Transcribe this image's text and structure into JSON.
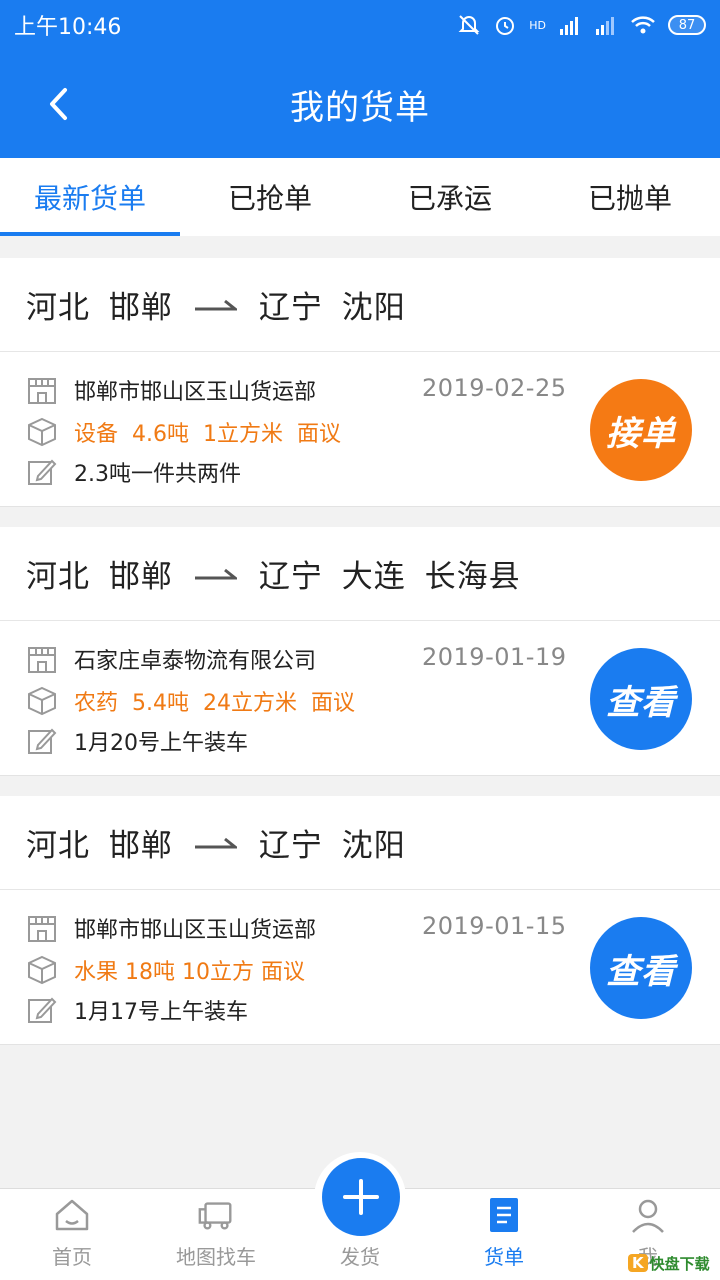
{
  "status": {
    "time": "上午10:46",
    "battery": "87",
    "network": "HD"
  },
  "header": {
    "title": "我的货单"
  },
  "tabs": [
    {
      "label": "最新货单",
      "active": true
    },
    {
      "label": "已抢单",
      "active": false
    },
    {
      "label": "已承运",
      "active": false
    },
    {
      "label": "已抛单",
      "active": false
    }
  ],
  "orders": [
    {
      "from": "河北 邯郸",
      "to": "辽宁 沈阳",
      "company": "邯郸市邯山区玉山货运部",
      "date": "2019-02-25",
      "cargo": "设备  4.6吨  1立方米  面议",
      "note": "2.3吨一件共两件",
      "action": "接单",
      "action_color": "#f57a14"
    },
    {
      "from": "河北 邯郸",
      "to": "辽宁 大连 长海县",
      "company": "石家庄卓泰物流有限公司",
      "date": "2019-01-19",
      "cargo": "农药  5.4吨  24立方米  面议",
      "note": "1月20号上午装车",
      "action": "查看",
      "action_color": "#1a7cf0"
    },
    {
      "from": "河北 邯郸",
      "to": "辽宁 沈阳",
      "company": "邯郸市邯山区玉山货运部",
      "date": "2019-01-15",
      "cargo": "水果 18吨 10立方 面议",
      "note": "1月17号上午装车",
      "action": "查看",
      "action_color": "#1a7cf0"
    }
  ],
  "bottom_nav": [
    {
      "label": "首页",
      "icon": "home-icon"
    },
    {
      "label": "地图找车",
      "icon": "truck-icon"
    },
    {
      "label": "发货",
      "icon": "plus-icon"
    },
    {
      "label": "货单",
      "icon": "document-icon",
      "active": true
    },
    {
      "label": "我",
      "icon": "user-icon"
    }
  ],
  "watermark": {
    "badge": "K",
    "text": "快盘下载"
  },
  "colors": {
    "primary": "#1a7cf0",
    "accent": "#f57a14"
  }
}
